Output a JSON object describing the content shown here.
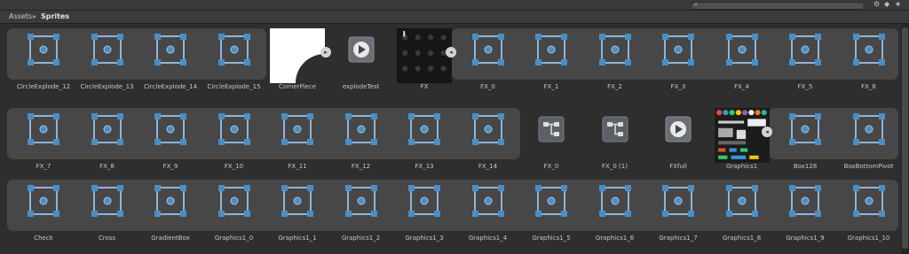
{
  "breadcrumb": {
    "root": "Assets",
    "separator": "▸",
    "current": "Sprites"
  },
  "toolbar": {
    "search_placeholder": "",
    "icons": [
      "search-icon",
      "filter-icon",
      "tag-icon",
      "star-icon"
    ]
  },
  "icons": {
    "sprite": "sprite-frame-icon",
    "play": "play-icon",
    "anim": "animator-icon",
    "expand": "expand-arrow-icon",
    "collapse": "collapse-arrow-icon"
  },
  "rows": [
    {
      "items": [
        {
          "label": "CircleExplode_12",
          "kind": "sprite"
        },
        {
          "label": "CircleExplode_13",
          "kind": "sprite"
        },
        {
          "label": "CircleExplode_14",
          "kind": "sprite"
        },
        {
          "label": "CircleExplode_15",
          "kind": "sprite"
        },
        {
          "label": "CornerPiece",
          "kind": "texture-corner"
        },
        {
          "label": "explodeTest",
          "kind": "clip"
        },
        {
          "label": "FX",
          "kind": "texture-dark"
        },
        {
          "label": "FX_0",
          "kind": "sprite"
        },
        {
          "label": "FX_1",
          "kind": "sprite"
        },
        {
          "label": "FX_2",
          "kind": "sprite"
        },
        {
          "label": "FX_3",
          "kind": "sprite"
        },
        {
          "label": "FX_4",
          "kind": "sprite"
        },
        {
          "label": "FX_5",
          "kind": "sprite"
        },
        {
          "label": "FX_6",
          "kind": "sprite"
        }
      ]
    },
    {
      "items": [
        {
          "label": "FX_7",
          "kind": "sprite"
        },
        {
          "label": "FX_8",
          "kind": "sprite"
        },
        {
          "label": "FX_9",
          "kind": "sprite"
        },
        {
          "label": "FX_10",
          "kind": "sprite"
        },
        {
          "label": "FX_11",
          "kind": "sprite"
        },
        {
          "label": "FX_12",
          "kind": "sprite"
        },
        {
          "label": "FX_13",
          "kind": "sprite"
        },
        {
          "label": "FX_14",
          "kind": "sprite"
        },
        {
          "label": "FX_0",
          "kind": "controller"
        },
        {
          "label": "FX_0 (1)",
          "kind": "controller"
        },
        {
          "label": "FXfull",
          "kind": "clip"
        },
        {
          "label": "Graphics1",
          "kind": "texture-atlas"
        },
        {
          "label": "Box128",
          "kind": "sprite"
        },
        {
          "label": "BoxBottomPivot",
          "kind": "sprite"
        }
      ]
    },
    {
      "items": [
        {
          "label": "Check",
          "kind": "sprite"
        },
        {
          "label": "Cross",
          "kind": "sprite"
        },
        {
          "label": "GradientBox",
          "kind": "sprite"
        },
        {
          "label": "Graphics1_0",
          "kind": "sprite"
        },
        {
          "label": "Graphics1_1",
          "kind": "sprite"
        },
        {
          "label": "Graphics1_2",
          "kind": "sprite"
        },
        {
          "label": "Graphics1_3",
          "kind": "sprite"
        },
        {
          "label": "Graphics1_4",
          "kind": "sprite"
        },
        {
          "label": "Graphics1_5",
          "kind": "sprite"
        },
        {
          "label": "Graphics1_6",
          "kind": "sprite"
        },
        {
          "label": "Graphics1_7",
          "kind": "sprite"
        },
        {
          "label": "Graphics1_8",
          "kind": "sprite"
        },
        {
          "label": "Graphics1_9",
          "kind": "sprite"
        },
        {
          "label": "Graphics1_10",
          "kind": "sprite"
        }
      ]
    }
  ]
}
